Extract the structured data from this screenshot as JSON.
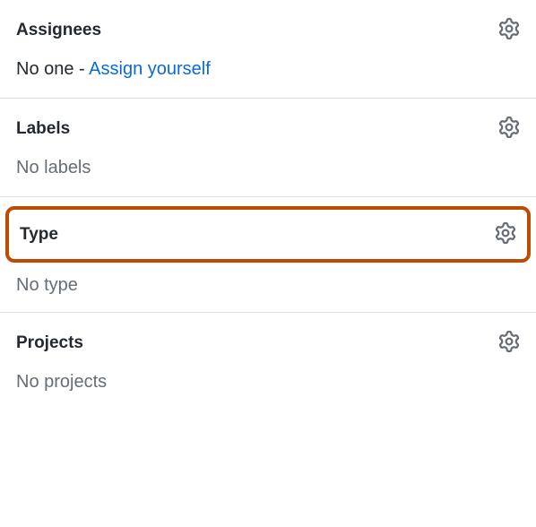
{
  "assignees": {
    "title": "Assignees",
    "none_prefix": "No one - ",
    "assign_self_link": "Assign yourself"
  },
  "labels": {
    "title": "Labels",
    "none_text": "No labels"
  },
  "type": {
    "title": "Type",
    "none_text": "No type"
  },
  "projects": {
    "title": "Projects",
    "none_text": "No projects"
  },
  "colors": {
    "highlight_border": "#bc4c00",
    "link": "#0969da"
  }
}
